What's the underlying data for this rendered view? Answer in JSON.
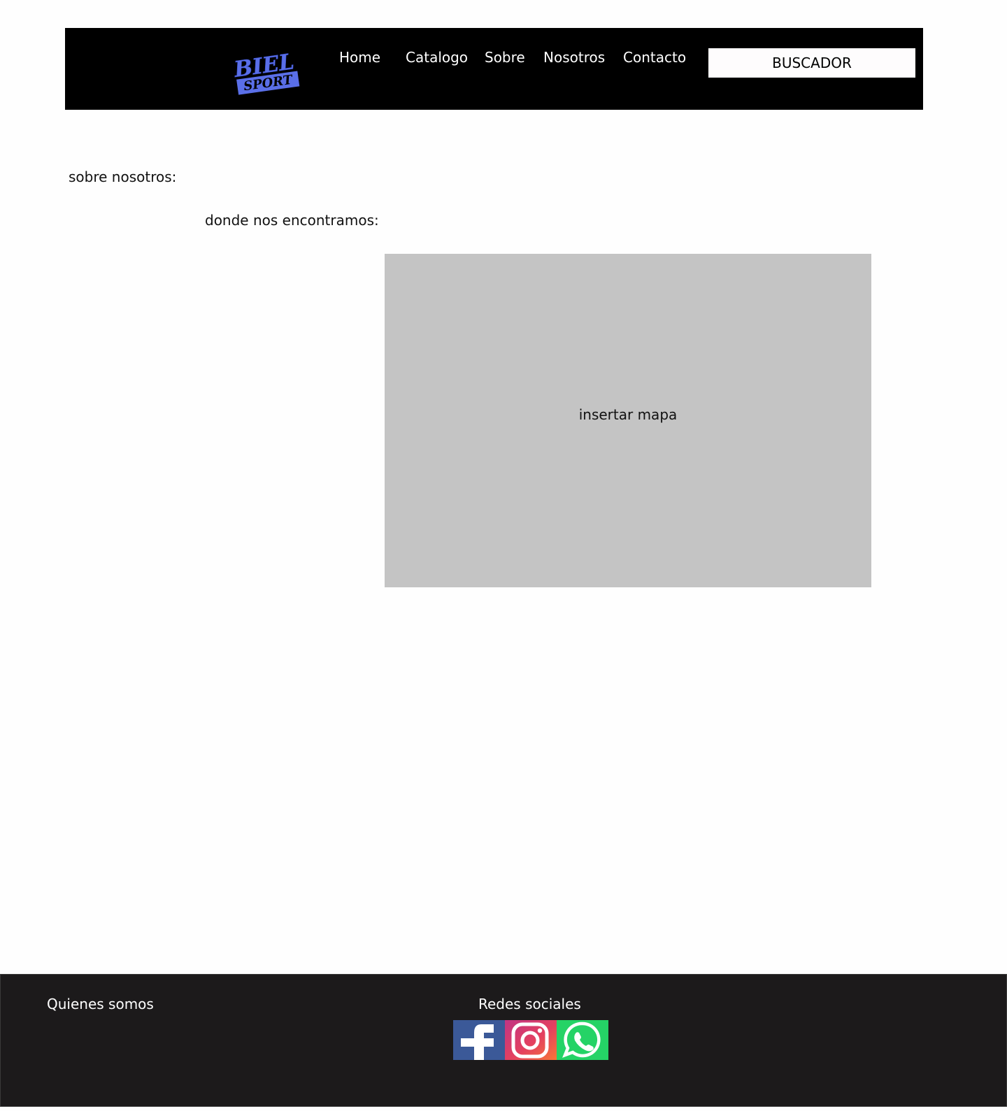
{
  "header": {
    "logo": {
      "line1": "BIEL",
      "line2": "SPORT",
      "color": "#5a6fe8"
    },
    "nav": [
      {
        "label": "Home"
      },
      {
        "label": "Catalogo"
      },
      {
        "label": "Sobre"
      },
      {
        "label": "Nosotros"
      },
      {
        "label": "Contacto"
      }
    ],
    "search": {
      "label": "BUSCADOR"
    }
  },
  "main": {
    "about_label": "sobre nosotros:",
    "location_label": "donde nos encontramos:",
    "map_placeholder": "insertar mapa"
  },
  "footer": {
    "about": "Quienes somos",
    "social_title": "Redes sociales",
    "social": [
      {
        "icon": "facebook-icon",
        "color": "#3b5998"
      },
      {
        "icon": "instagram-icon",
        "color": "#e4405f"
      },
      {
        "icon": "whatsapp-icon",
        "color": "#25d366"
      }
    ]
  }
}
